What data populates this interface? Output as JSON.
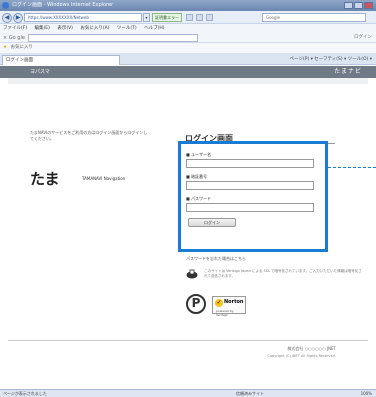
{
  "window": {
    "title": "ログイン画面 - Windows Internet Explorer"
  },
  "address": {
    "url": "https://www.XXXXXXX/Netweb",
    "cert_label": "証明書エラー",
    "search_placeholder": "Google"
  },
  "menu": [
    "ファイル(F)",
    "編集(E)",
    "表示(V)",
    "お気に入り(A)",
    "ツール(T)",
    "ヘルプ(H)"
  ],
  "links": {
    "label": "× Go gle",
    "right": "ログイン"
  },
  "favorites": {
    "label": "お気に入り"
  },
  "tab": {
    "label": "ログイン画面"
  },
  "command_bar": {
    "items": "ページ(P) ▾  セーフティ(S) ▾  ツール(O) ▾"
  },
  "page_header": {
    "left": "ヨパスマ",
    "right": "たまナビ"
  },
  "left_text": "たまNAVIのサービスをご利用の方はログイン画面からログインしてください。",
  "logo": {
    "mark": "たま",
    "brand_en": "TAMANAVI Navigation"
  },
  "login": {
    "title": "ログイン画面",
    "user_label": "■ ユーザー名",
    "pass_label": "■ 暗証番号",
    "password_label": "■ パスワード",
    "button_label": "ログイン",
    "forgot": "パスワードを忘れた場合はこちら"
  },
  "ssl_text": "このサイトは Verisign Japan による SSL で暗号化されています。ご入力いただいた情報は暗号化されて送信されます。",
  "norton": {
    "name": "Norton",
    "sub": "powered by VeriSign"
  },
  "footer": {
    "line1": "株式会社 ○○○○○○ JNET",
    "line2": "Copyright (C) JNET All Rights Reserved."
  },
  "status": {
    "left": "ページが表示されました",
    "security": "信頼済みサイト",
    "zoom": "100%"
  }
}
